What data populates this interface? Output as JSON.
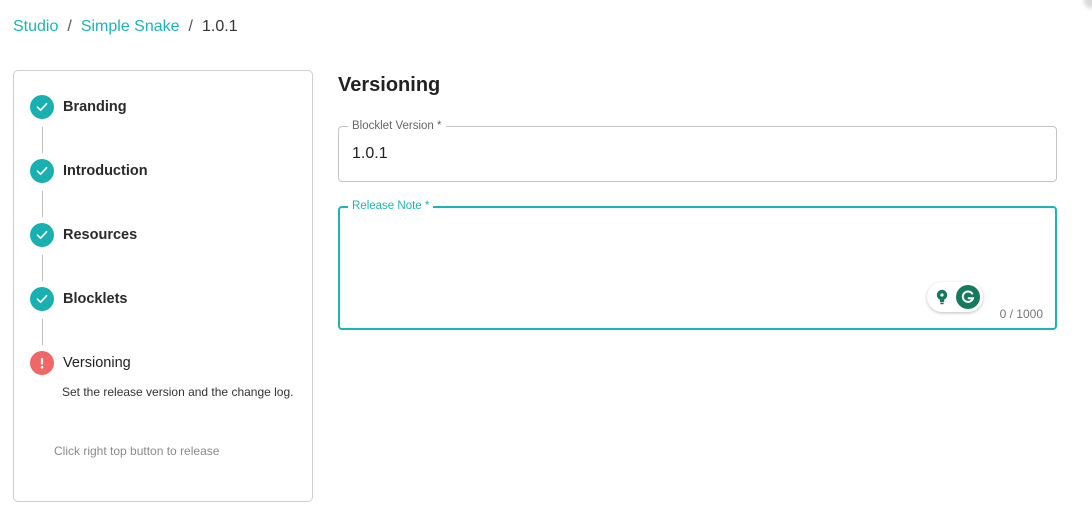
{
  "breadcrumb": {
    "items": [
      {
        "label": "Studio"
      },
      {
        "label": "Simple Snake"
      },
      {
        "label": "1.0.1"
      }
    ],
    "separator": "/"
  },
  "stepper": {
    "steps": [
      {
        "label": "Branding",
        "status": "done"
      },
      {
        "label": "Introduction",
        "status": "done"
      },
      {
        "label": "Resources",
        "status": "done"
      },
      {
        "label": "Blocklets",
        "status": "done"
      },
      {
        "label": "Versioning",
        "status": "error"
      }
    ],
    "active_description": "Set the release version and the change log.",
    "hint": "Click right top button to release"
  },
  "main": {
    "title": "Versioning",
    "version_field": {
      "label": "Blocklet Version *",
      "value": "1.0.1"
    },
    "note_field": {
      "label": "Release Note *",
      "value": "",
      "counter": "0 / 1000"
    }
  },
  "colors": {
    "accent": "#1bb5b5",
    "done": "#1ab0b0",
    "error": "#ef6767",
    "grammarly": "#15795c"
  }
}
